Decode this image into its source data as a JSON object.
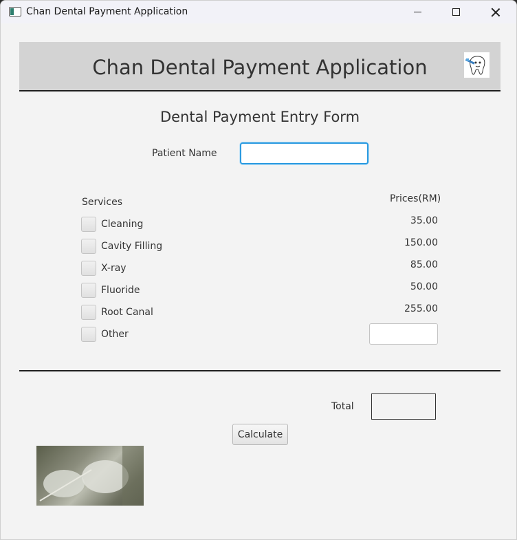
{
  "window": {
    "title": "Chan Dental Payment Application"
  },
  "banner": {
    "title": "Chan Dental Payment Application",
    "logo_icon": "tooth-cartoon-icon"
  },
  "form": {
    "title": "Dental Payment Entry Form",
    "patient_label": "Patient Name",
    "patient_value": "",
    "services_header": "Services",
    "prices_header": "Prices(RM)",
    "services": [
      {
        "name": "Cleaning",
        "price": "35.00",
        "checked": false
      },
      {
        "name": "Cavity Filling",
        "price": "150.00",
        "checked": false
      },
      {
        "name": "X-ray",
        "price": "85.00",
        "checked": false
      },
      {
        "name": "Fluoride",
        "price": "50.00",
        "checked": false
      },
      {
        "name": "Root Canal",
        "price": "255.00",
        "checked": false
      },
      {
        "name": "Other",
        "price": "",
        "checked": false
      }
    ],
    "other_price_value": "",
    "total_label": "Total",
    "total_value": "",
    "calculate_label": "Calculate"
  },
  "colors": {
    "accent_focus": "#2b9ae0",
    "banner_bg": "#d3d3d3"
  }
}
